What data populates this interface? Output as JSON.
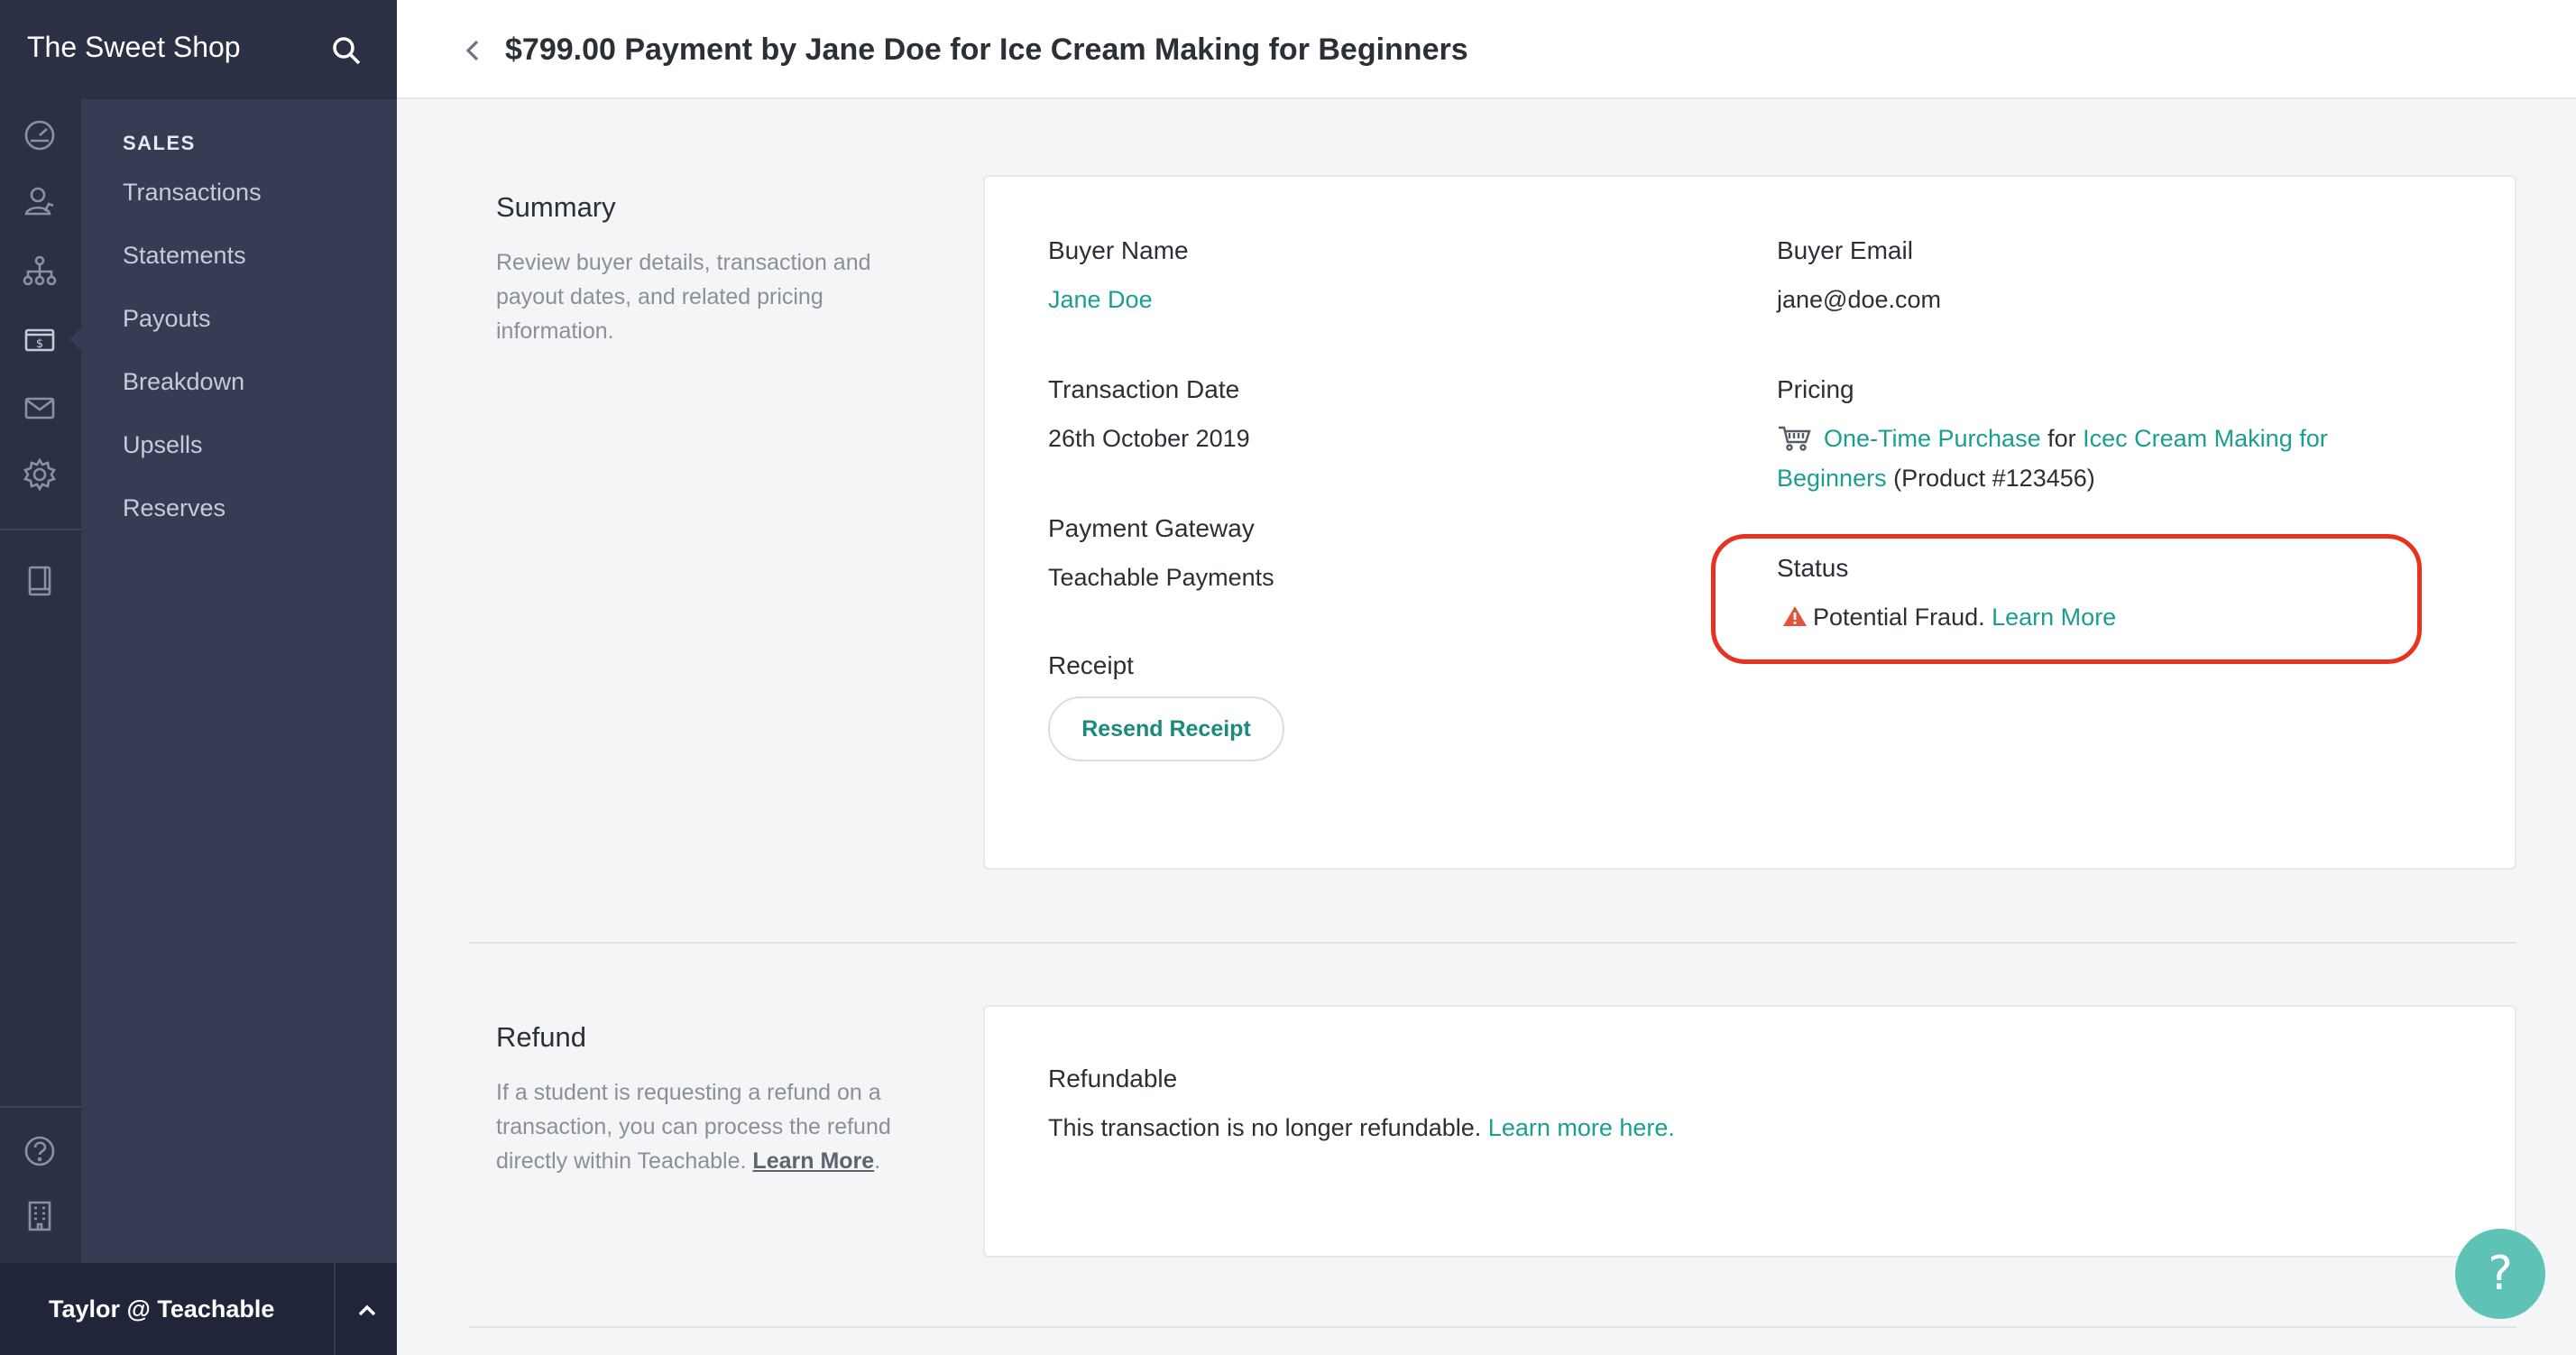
{
  "sidebar": {
    "shop_name": "The Sweet Shop",
    "section_heading": "SALES",
    "items": [
      {
        "label": "Transactions"
      },
      {
        "label": "Statements"
      },
      {
        "label": "Payouts"
      },
      {
        "label": "Breakdown"
      },
      {
        "label": "Upsells"
      },
      {
        "label": "Reserves"
      }
    ],
    "rail_icons": [
      "dashboard-icon",
      "users-icon",
      "sitemap-icon",
      "sales-icon",
      "mail-icon",
      "settings-icon",
      "book-icon",
      "help-icon",
      "building-icon"
    ],
    "user_label": "Taylor @ Teachable"
  },
  "header": {
    "title": "$799.00 Payment by Jane Doe for Ice Cream Making for Beginners"
  },
  "summary": {
    "title": "Summary",
    "description": "Review buyer details, transaction and payout dates, and related pricing information.",
    "buyer_name_label": "Buyer Name",
    "buyer_name": "Jane Doe",
    "buyer_email_label": "Buyer Email",
    "buyer_email": "jane@doe.com",
    "transaction_date_label": "Transaction Date",
    "transaction_date": "26th October 2019",
    "pricing_label": "Pricing",
    "pricing_plan": "One-Time Purchase",
    "pricing_for": "for",
    "pricing_product_line1": "Icec Cream Making for",
    "pricing_product_line2": "Beginners",
    "pricing_product_id": "(Product #123456)",
    "gateway_label": "Payment Gateway",
    "gateway": "Teachable Payments",
    "status_label": "Status",
    "status_text": "Potential Fraud.",
    "status_link": "Learn More",
    "receipt_label": "Receipt",
    "resend_button": "Resend Receipt"
  },
  "refund": {
    "title": "Refund",
    "description": "If a student is requesting a refund on a transaction, you can process the refund directly within Teachable.",
    "description_link": "Learn More",
    "refundable_label": "Refundable",
    "refundable_text": "This transaction is no longer refundable.",
    "refundable_link": "Learn more here"
  },
  "help_button": "?",
  "colors": {
    "sidebar_bg": "#2c3044",
    "subnav_bg": "#373c55",
    "accent": "#1a9e8f",
    "highlight": "#e8321f",
    "help_bg": "#5fc2b6"
  }
}
